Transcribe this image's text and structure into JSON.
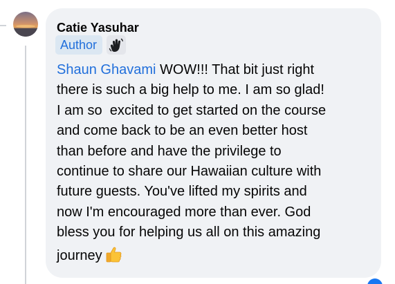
{
  "comment": {
    "author_name": "Catie Yasuhar",
    "author_badge": "Author",
    "badge_icon": "waving-hand-icon",
    "mention": "Shaun Ghavami",
    "lines": [
      " WOW!!! That bit just right",
      "there is such a big help to me. I am so glad!",
      "I am so  excited to get started on the course",
      "and come back to be an even better host",
      "than before and have the privilege to",
      "continue to share our Hawaiian culture with",
      "future guests. You've lifted my spirits and",
      "now I'm encouraged more than ever. God",
      "bless you for helping us all on this amazing",
      "journey"
    ],
    "trailing_emoji": "thumbs-up-emoji"
  },
  "colors": {
    "bubble_background": "#f0f2f5",
    "mention_link": "#216fdb",
    "badge_background": "#dbe7f2",
    "text": "#050505"
  }
}
